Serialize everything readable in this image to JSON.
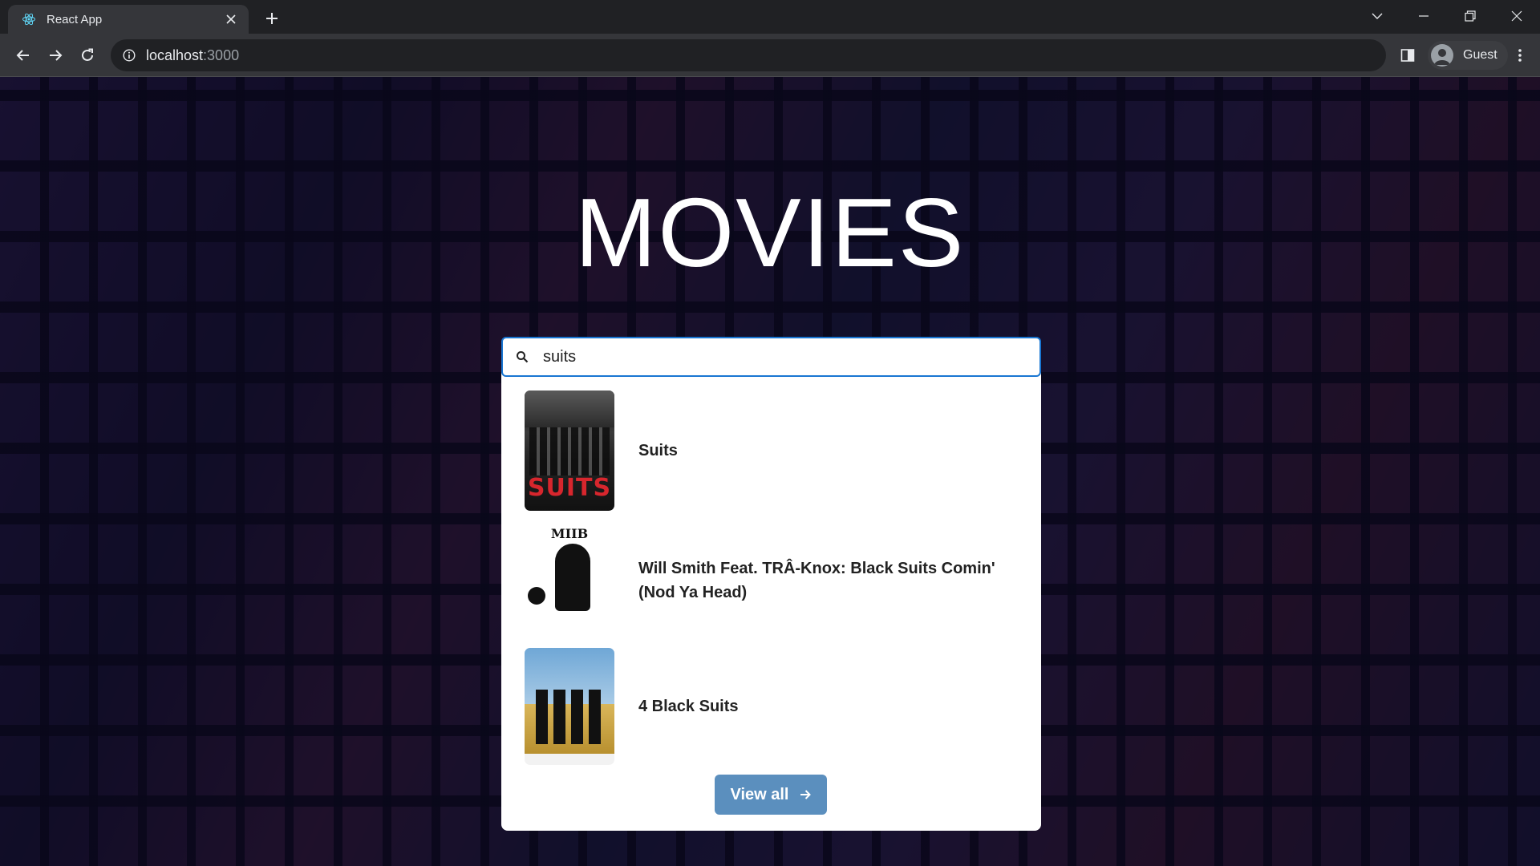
{
  "browser": {
    "tab_title": "React App",
    "url_host": "localhost",
    "url_port": ":3000",
    "profile_label": "Guest"
  },
  "page": {
    "title": "MOVIES",
    "search": {
      "value": "suits"
    },
    "results": [
      {
        "title": "Suits"
      },
      {
        "title": "Will Smith Feat. TRÂ-Knox: Black Suits Comin' (Nod Ya Head)"
      },
      {
        "title": "4 Black Suits"
      }
    ],
    "view_all_label": "View all",
    "posters": {
      "suits_word": "SUITS",
      "miib_logo": "MIIB"
    }
  },
  "colors": {
    "search_border": "#1976d2",
    "view_all_bg": "#5b8fbe",
    "page_bg": "#12102a"
  }
}
